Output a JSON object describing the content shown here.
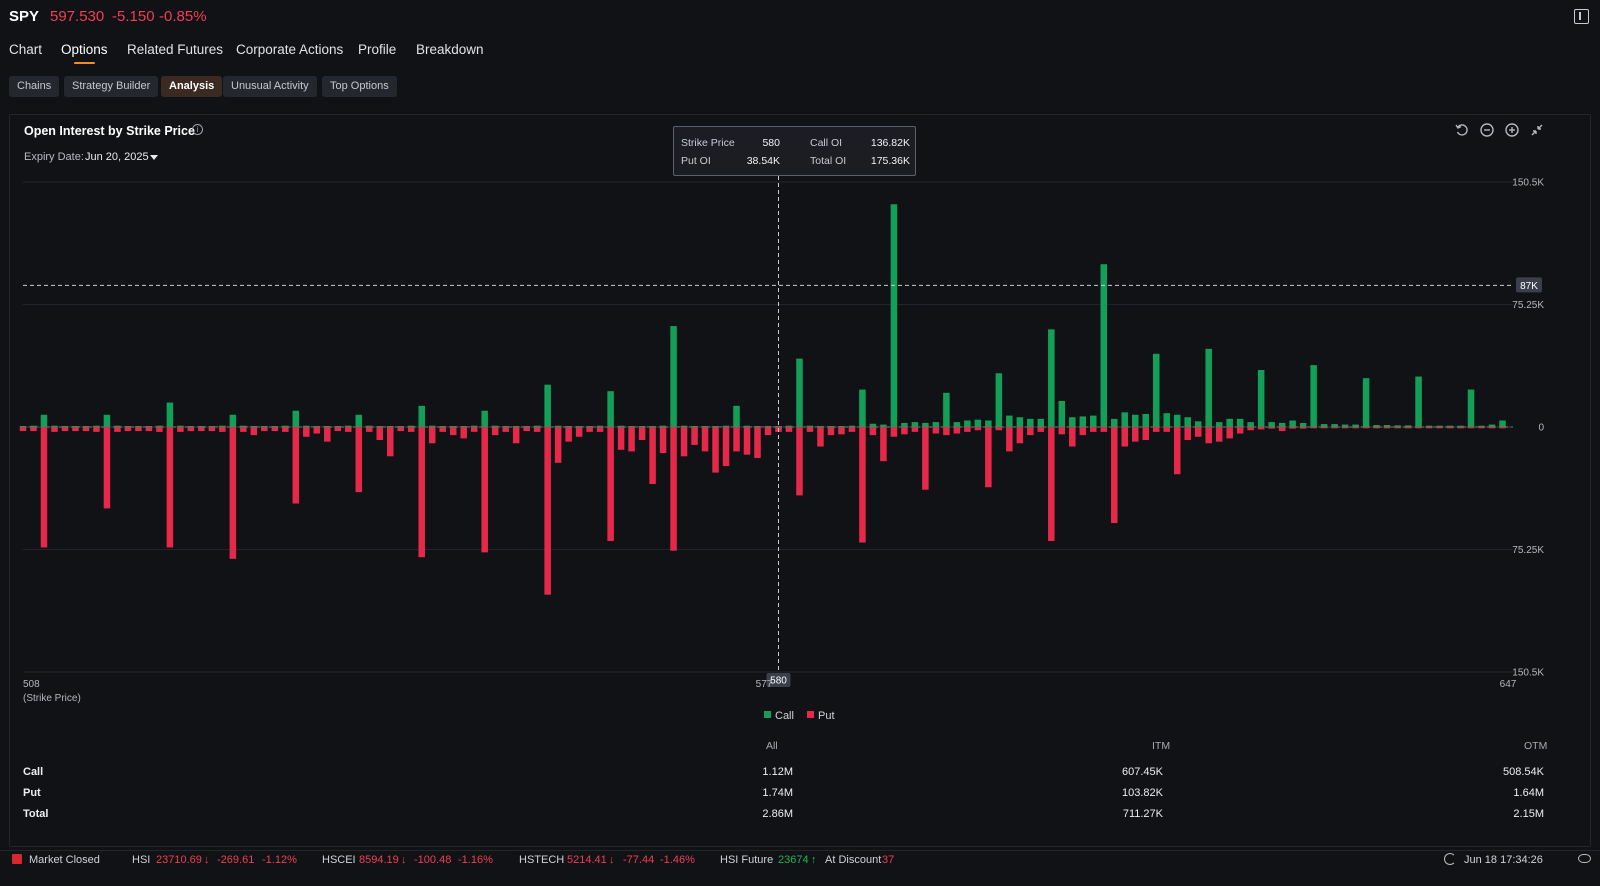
{
  "header": {
    "ticker": "SPY",
    "price": "597.530",
    "change": "-5.150",
    "change_pct": "-0.85%"
  },
  "nav": {
    "tabs": [
      "Chart",
      "Options",
      "Related Futures",
      "Corporate Actions",
      "Profile",
      "Breakdown"
    ],
    "active": "Options"
  },
  "subnav": {
    "tabs": [
      "Chains",
      "Strategy Builder",
      "Analysis",
      "Unusual Activity",
      "Top Options"
    ],
    "active": "Analysis"
  },
  "panel": {
    "title": "Open Interest by Strike Price",
    "expiry_label": "Expiry Date:",
    "expiry_value": "Jun 20, 2025",
    "controls": [
      "undo-icon",
      "zoom-out-icon",
      "zoom-in-icon",
      "shrink-icon"
    ]
  },
  "tooltip": {
    "strike_label": "Strike Price",
    "strike_value": "580",
    "call_label": "Call OI",
    "call_value": "136.82K",
    "put_label": "Put OI",
    "put_value": "38.54K",
    "total_label": "Total OI",
    "total_value": "175.36K"
  },
  "chart_data": {
    "type": "bar",
    "x_label_left": "508",
    "x_label_sub": "(Strike Price)",
    "x_label_mid": "577",
    "x_label_right": "647",
    "x_crosshair": "580",
    "y_crosshair": "87K",
    "y_crosshair_value": 87000,
    "y_ticks": [
      "150.5K",
      "75.25K",
      "0",
      "75.25K",
      "150.5K"
    ],
    "ylim": [
      -150500,
      150500
    ],
    "x_range": [
      508,
      650
    ],
    "legend": [
      "Call",
      "Put"
    ],
    "colors": {
      "call": "#12a058",
      "put": "#e6294a"
    },
    "strikes": [
      508,
      509,
      510,
      511,
      512,
      513,
      514,
      515,
      516,
      517,
      518,
      519,
      520,
      521,
      522,
      523,
      524,
      525,
      526,
      527,
      528,
      529,
      530,
      531,
      532,
      533,
      534,
      535,
      536,
      537,
      538,
      539,
      540,
      541,
      542,
      543,
      544,
      545,
      546,
      547,
      548,
      549,
      550,
      551,
      552,
      553,
      554,
      555,
      556,
      557,
      558,
      559,
      560,
      561,
      562,
      563,
      564,
      565,
      566,
      567,
      568,
      569,
      570,
      571,
      572,
      573,
      574,
      575,
      576,
      577,
      578,
      579,
      580,
      581,
      582,
      583,
      584,
      585,
      586,
      587,
      588,
      589,
      590,
      591,
      592,
      593,
      594,
      595,
      596,
      597,
      598,
      599,
      600,
      601,
      602,
      603,
      604,
      605,
      606,
      607,
      608,
      609,
      610,
      611,
      612,
      613,
      614,
      615,
      616,
      617,
      618,
      619,
      620,
      621,
      622,
      623,
      624,
      625,
      626,
      627,
      628,
      629,
      630,
      631,
      632,
      633,
      634,
      635,
      636,
      637,
      638,
      639,
      640,
      641,
      642,
      643,
      644,
      645,
      646,
      647,
      648,
      649
    ],
    "call": [
      500,
      800,
      7500,
      800,
      500,
      500,
      500,
      800,
      7500,
      800,
      500,
      500,
      500,
      800,
      15000,
      800,
      500,
      500,
      500,
      800,
      7500,
      800,
      500,
      500,
      500,
      800,
      10000,
      800,
      500,
      500,
      500,
      800,
      7500,
      800,
      500,
      500,
      500,
      800,
      13000,
      800,
      500,
      500,
      500,
      800,
      10000,
      800,
      500,
      500,
      500,
      800,
      26000,
      800,
      500,
      500,
      500,
      800,
      22000,
      800,
      500,
      500,
      500,
      800,
      62000,
      800,
      500,
      500,
      500,
      800,
      13000,
      800,
      500,
      500,
      500,
      800,
      42000,
      800,
      500,
      500,
      500,
      800,
      23000,
      2000,
      1500,
      136820,
      2500,
      3000,
      2500,
      3000,
      21000,
      3000,
      4000,
      4500,
      4000,
      33000,
      7000,
      6000,
      5000,
      5000,
      60000,
      16000,
      6000,
      6500,
      7000,
      100000,
      5000,
      9000,
      7500,
      8000,
      45000,
      8500,
      7500,
      6000,
      3500,
      48000,
      3000,
      5000,
      5000,
      3000,
      35000,
      3000,
      2500,
      4000,
      2500,
      38000,
      1800,
      1800,
      1500,
      1500,
      30000,
      1200,
      1200,
      1000,
      1000,
      31000,
      800,
      800,
      800,
      800,
      23000,
      800,
      1500,
      4000,
      2000,
      33000,
      800,
      800,
      800,
      800,
      15000,
      800,
      600
    ],
    "put": [
      2500,
      2500,
      74000,
      3000,
      2500,
      2500,
      2500,
      3000,
      50000,
      3000,
      2500,
      2500,
      2500,
      3000,
      74000,
      3000,
      2500,
      2500,
      2500,
      3000,
      81000,
      3000,
      5000,
      2500,
      2500,
      3000,
      47000,
      6000,
      4000,
      9000,
      2500,
      3000,
      40000,
      3000,
      8000,
      18000,
      2500,
      3000,
      80000,
      10000,
      3000,
      5000,
      7000,
      3000,
      77000,
      5000,
      3000,
      10000,
      2500,
      3000,
      103000,
      22000,
      9000,
      6000,
      3000,
      3000,
      70000,
      14000,
      15000,
      8000,
      35000,
      16000,
      76000,
      18000,
      11000,
      15000,
      28000,
      24000,
      15000,
      17000,
      19000,
      5000,
      3000,
      3000,
      42000,
      3000,
      12000,
      5000,
      4500,
      3000,
      71000,
      5000,
      21000,
      6000,
      4500,
      3000,
      38540,
      4000,
      5000,
      4000,
      3000,
      2000,
      37000,
      2000,
      15000,
      10000,
      5000,
      3000,
      70000,
      4500,
      12000,
      5000,
      3000,
      3000,
      59000,
      12000,
      9000,
      8000,
      3000,
      3000,
      29000,
      8000,
      6000,
      10000,
      9000,
      7000,
      4000,
      2000,
      1500,
      1000,
      2500,
      1000,
      1000,
      800,
      800,
      800,
      800,
      800,
      800,
      800,
      800,
      800,
      800,
      800,
      800,
      800,
      800,
      800,
      800,
      800,
      800,
      800,
      800,
      800,
      800,
      800,
      800,
      800,
      800,
      800
    ]
  },
  "summary": {
    "headers": [
      "All",
      "ITM",
      "OTM"
    ],
    "rows": [
      {
        "label": "Call",
        "all": "1.12M",
        "itm": "607.45K",
        "otm": "508.54K"
      },
      {
        "label": "Put",
        "all": "1.74M",
        "itm": "103.82K",
        "otm": "1.64M"
      },
      {
        "label": "Total",
        "all": "2.86M",
        "itm": "711.27K",
        "otm": "2.15M"
      }
    ]
  },
  "status": {
    "market": "Market Closed",
    "hsi_label": "HSI",
    "hsi_value": "23710.69",
    "hsi_change": "-269.61",
    "hsi_pct": "-1.12%",
    "hscei_label": "HSCEI",
    "hscei_value": "8594.19",
    "hscei_change": "-100.48",
    "hscei_pct": "-1.16%",
    "hstech_label": "HSTECH",
    "hstech_value": "5214.41",
    "hstech_change": "-77.44",
    "hstech_pct": "-1.46%",
    "future_label": "HSI Future",
    "future_value": "23674",
    "discount_label": "At Discount",
    "discount_value": "37",
    "datetime": "Jun 18 17:34:26"
  }
}
